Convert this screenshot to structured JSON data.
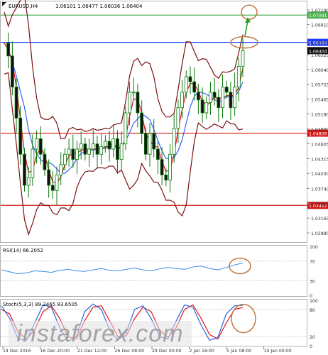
{
  "header": {
    "symbol": "EURUSD,H4",
    "ohlc": "1.06101 1.06477 1.06036 1.06404"
  },
  "chart_data": {
    "type": "candlestick",
    "price_ticks": [
      "1.07190",
      "1.06910",
      "1.06565",
      "1.06325",
      "1.06040",
      "1.05755",
      "1.05465",
      "1.05180",
      "1.04890",
      "1.04605",
      "1.04315",
      "1.04030",
      "1.03740",
      "1.03455",
      "1.03165",
      "1.02880"
    ],
    "price_ylim": [
      1.0288,
      1.0719
    ],
    "levels": [
      {
        "value": 1.07091,
        "label": "1.07091",
        "color": "#4caf50"
      },
      {
        "value": 1.06564,
        "label": "1.06564",
        "color": "#1e3cff"
      },
      {
        "value": 1.04808,
        "label": "1.04808",
        "color": "#d01414"
      },
      {
        "value": 1.03412,
        "label": "1.03412",
        "color": "#d01414"
      }
    ],
    "current_price": {
      "value": 1.06404,
      "label": "1.06404"
    },
    "x_labels": [
      "14 Dec 2016",
      "16 Dec 20:00",
      "21 Dec 12:00",
      "26 Dec 08:00",
      "29 Dec 00:00",
      "2 Jan 16:00",
      "5 Jan 08:00",
      "10 Jan 00:00"
    ],
    "price_path": [
      1.0655,
      1.063,
      1.057,
      1.051,
      1.044,
      1.038,
      1.0395,
      1.045,
      1.047,
      1.044,
      1.041,
      1.038,
      1.037,
      1.04,
      1.042,
      1.044,
      1.045,
      1.043,
      1.045,
      1.046,
      1.044,
      1.045,
      1.046,
      1.044,
      1.0455,
      1.0465,
      1.045,
      1.047,
      1.043,
      1.046,
      1.052,
      1.056,
      1.056,
      1.052,
      1.048,
      1.044,
      1.048,
      1.045,
      1.043,
      1.04,
      1.039,
      1.044,
      1.049,
      1.053,
      1.056,
      1.059,
      1.058,
      1.056,
      1.0545,
      1.052,
      1.054,
      1.056,
      1.055,
      1.053,
      1.057,
      1.056,
      1.053,
      1.057,
      1.061,
      1.064
    ],
    "rsi": {
      "label": "RSI(14) 66.2052",
      "ticks": [
        "100",
        "70",
        "30",
        "0"
      ],
      "values": [
        52,
        48,
        44,
        46,
        50,
        49,
        47,
        51,
        53,
        50,
        49,
        52,
        55,
        51,
        50,
        53,
        56,
        52,
        50,
        54,
        57,
        55,
        53,
        58,
        60,
        55,
        52,
        57,
        62,
        66
      ]
    },
    "stoch": {
      "label": "Stoch(5,3,3) 89.2465 83.6505",
      "ticks": [
        "100",
        "80",
        "20",
        "0"
      ],
      "main": [
        88,
        60,
        15,
        12,
        50,
        90,
        85,
        40,
        10,
        20,
        75,
        92,
        80,
        35,
        12,
        30,
        80,
        88,
        60,
        20,
        15,
        55,
        90,
        85,
        45,
        12,
        18,
        70,
        88,
        89
      ],
      "signal": [
        80,
        70,
        30,
        15,
        35,
        75,
        88,
        60,
        20,
        15,
        55,
        85,
        88,
        55,
        20,
        22,
        60,
        85,
        75,
        35,
        18,
        40,
        80,
        90,
        60,
        25,
        15,
        50,
        80,
        84
      ]
    }
  },
  "watermark": {
    "text": "instaforex.com"
  }
}
